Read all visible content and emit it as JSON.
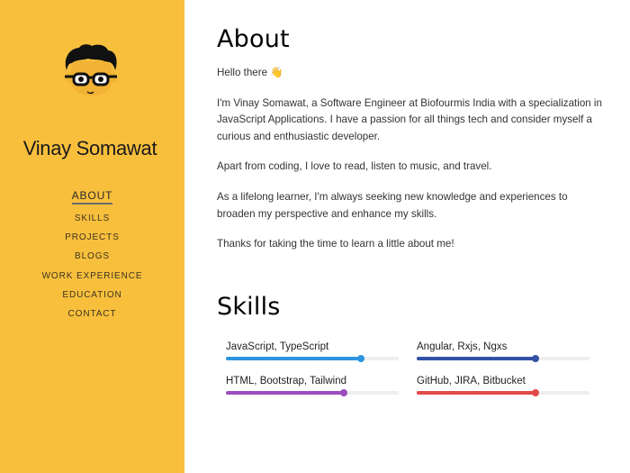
{
  "profile": {
    "name": "Vinay Somawat",
    "avatar_icon": "developer-avatar-icon"
  },
  "nav": [
    {
      "label": "ABOUT",
      "active": true
    },
    {
      "label": "SKILLS",
      "active": false
    },
    {
      "label": "PROJECTS",
      "active": false
    },
    {
      "label": "BLOGS",
      "active": false
    },
    {
      "label": "WORK EXPERIENCE",
      "active": false
    },
    {
      "label": "EDUCATION",
      "active": false
    },
    {
      "label": "CONTACT",
      "active": false
    }
  ],
  "about": {
    "title": "About",
    "paragraphs": [
      "Hello there 👋",
      "I'm Vinay Somawat, a Software Engineer at Biofourmis India with a specialization in JavaScript Applications. I have a passion for all things tech and consider myself a curious and enthusiastic developer.",
      "Apart from coding, I love to read, listen to music, and travel.",
      "As a lifelong learner, I'm always seeking new knowledge and experiences to broaden my perspective and enhance my skills.",
      "Thanks for taking the time to learn a little about me!"
    ]
  },
  "skills": {
    "title": "Skills",
    "items": [
      {
        "label": "JavaScript, TypeScript",
        "level": 0.78,
        "color": "#2f94e0"
      },
      {
        "label": "Angular, Rxjs, Ngxs",
        "level": 0.69,
        "color": "#3451a8"
      },
      {
        "label": "HTML, Bootstrap, Tailwind",
        "level": 0.68,
        "color": "#9b4dbf"
      },
      {
        "label": "GitHub, JIRA, Bitbucket",
        "level": 0.69,
        "color": "#e24a4a"
      }
    ]
  },
  "colors": {
    "sidebar": "#f8bf3d"
  }
}
